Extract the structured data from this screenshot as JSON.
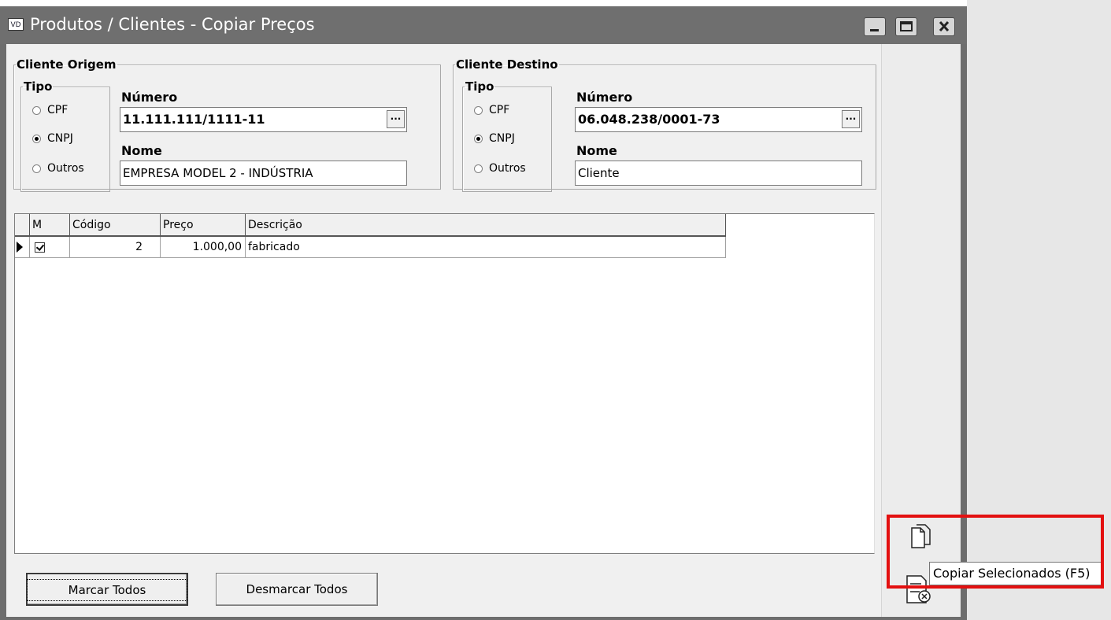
{
  "window": {
    "app_icon": "VD",
    "title": "Produtos / Clientes - Copiar Preços"
  },
  "cliente_origem": {
    "legend": "Cliente Origem",
    "tipo_legend": "Tipo",
    "options": [
      "CPF",
      "CNPJ",
      "Outros"
    ],
    "selected": "CNPJ",
    "numero_label": "Número",
    "numero_value": "11.111.111/1111-11",
    "nome_label": "Nome",
    "nome_value": "EMPRESA MODEL 2 - INDÚSTRIA",
    "lookup_label": "..."
  },
  "cliente_destino": {
    "legend": "Cliente Destino",
    "tipo_legend": "Tipo",
    "options": [
      "CPF",
      "CNPJ",
      "Outros"
    ],
    "selected": "CNPJ",
    "numero_label": "Número",
    "numero_value": "06.048.238/0001-73",
    "nome_label": "Nome",
    "nome_value": "Cliente",
    "lookup_label": "..."
  },
  "grid": {
    "columns": [
      "M",
      "Código",
      "Preço",
      "Descrição"
    ],
    "rows": [
      {
        "marked": true,
        "codigo": "2",
        "preco": "1.000,00",
        "descricao": "fabricado"
      }
    ]
  },
  "buttons": {
    "marcar_todos": "Marcar Todos",
    "desmarcar_todos": "Desmarcar Todos"
  },
  "toolbar": {
    "copy_icon": "copy-document-icon",
    "cancel_icon": "document-cancel-icon",
    "tooltip": "Copiar Selecionados (F5)"
  },
  "colors": {
    "titlebar": "#6f6f6f",
    "highlight": "#e31010"
  }
}
